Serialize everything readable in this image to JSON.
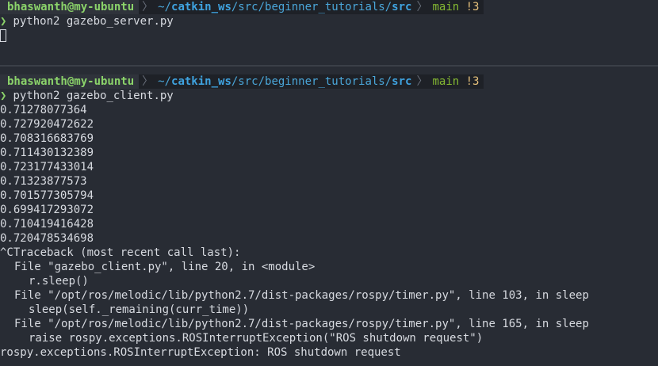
{
  "top_pane": {
    "prompt": {
      "user_host": "bhaswanth@my-ubuntu",
      "path_prefix": "~/",
      "path_bold": "catkin_ws",
      "path_middle": "/src/beginner_tutorials/",
      "path_last": "src",
      "git_branch": "main",
      "git_status": "!3",
      "separator_glyph": "〉"
    },
    "command": {
      "chevron": "❯",
      "text": "python2 gazebo_server.py"
    }
  },
  "bottom_pane": {
    "prompt": {
      "user_host": "bhaswanth@my-ubuntu",
      "path_prefix": "~/",
      "path_bold": "catkin_ws",
      "path_middle": "/src/beginner_tutorials/",
      "path_last": "src",
      "git_branch": "main",
      "git_status": "!3",
      "separator_glyph": "〉"
    },
    "command": {
      "chevron": "❯",
      "text": "python2 gazebo_client.py"
    },
    "output": [
      "0.71278077364",
      "0.727920472622",
      "0.708316683769",
      "0.711430132389",
      "0.723177433014",
      "0.71323877573",
      "0.701577305794",
      "0.699417293072",
      "0.710419416428",
      "0.720478534698",
      "^CTraceback (most recent call last):"
    ],
    "traceback": [
      {
        "indent": 1,
        "text": "File \"gazebo_client.py\", line 20, in <module>"
      },
      {
        "indent": 2,
        "text": "r.sleep()"
      },
      {
        "indent": 1,
        "text": "File \"/opt/ros/melodic/lib/python2.7/dist-packages/rospy/timer.py\", line 103, in sleep"
      },
      {
        "indent": 2,
        "text": "sleep(self._remaining(curr_time))"
      },
      {
        "indent": 1,
        "text": "File \"/opt/ros/melodic/lib/python2.7/dist-packages/rospy/timer.py\", line 165, in sleep"
      },
      {
        "indent": 2,
        "text": "raise rospy.exceptions.ROSInterruptException(\"ROS shutdown request\")"
      }
    ],
    "final_error": "rospy.exceptions.ROSInterruptException: ROS shutdown request"
  },
  "colors": {
    "background": "#282c34",
    "user_host": "#8bd36a",
    "path": "#4aa6d9",
    "git_branch": "#84b832",
    "git_dirty": "#e5c07b"
  }
}
